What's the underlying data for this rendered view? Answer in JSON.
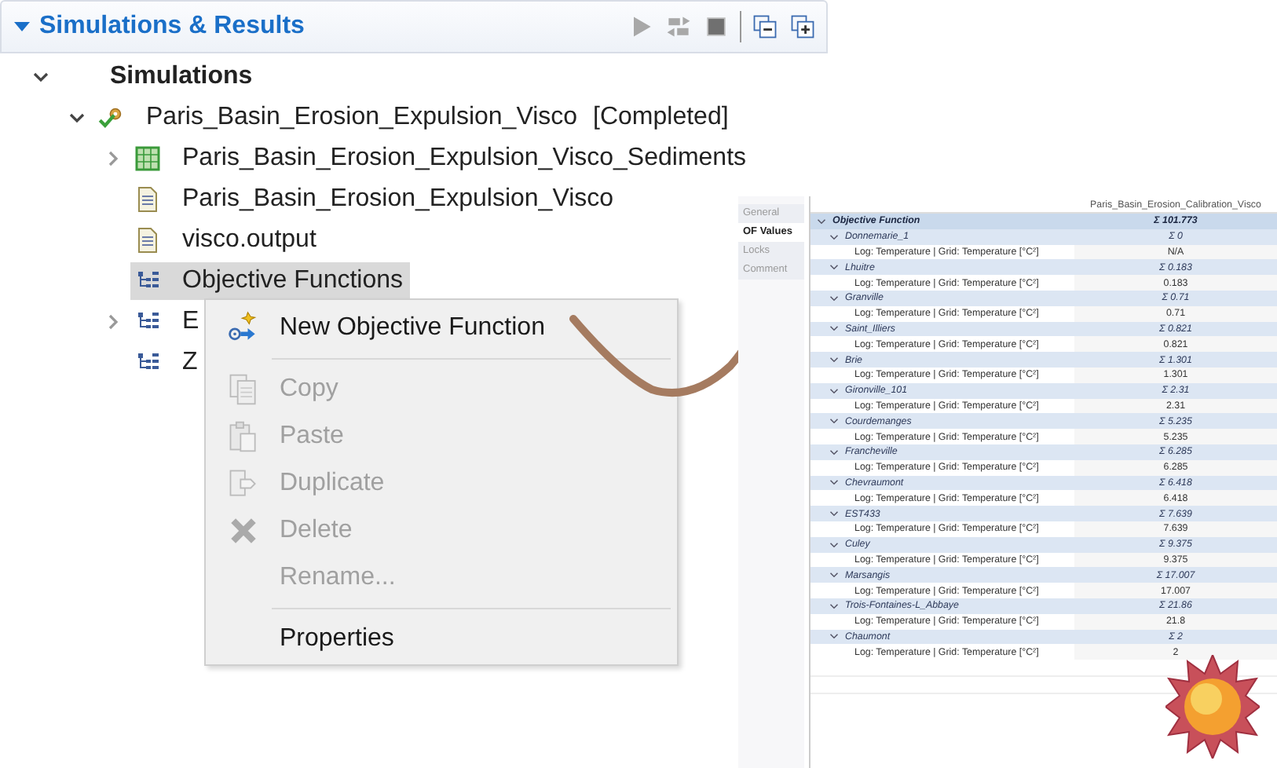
{
  "panel": {
    "title": "Simulations & Results",
    "expanded": true,
    "toolbar": [
      {
        "kind": "run",
        "disabled": true
      },
      {
        "kind": "sync",
        "disabled": true
      },
      {
        "kind": "stop",
        "disabled": true
      },
      {
        "kind": "separator"
      },
      {
        "kind": "collapse",
        "disabled": false
      },
      {
        "kind": "expand",
        "disabled": false
      }
    ]
  },
  "tree": [
    {
      "label": "Simulations",
      "kind": "root",
      "expanded": true,
      "selected": false,
      "children": [
        {
          "label": "Paris_Basin_Erosion_Expulsion_Visco",
          "status": "[Completed]",
          "kind": "simulation",
          "expanded": true,
          "selected": false,
          "children": [
            {
              "label": "Paris_Basin_Erosion_Expulsion_Visco_Sediments",
              "kind": "grid",
              "expanded": false,
              "selected": false
            },
            {
              "label": "Paris_Basin_Erosion_Expulsion_Visco",
              "kind": "file",
              "selected": false
            },
            {
              "label": "visco.output",
              "kind": "file",
              "selected": false
            },
            {
              "label": "Objective Functions",
              "kind": "functions",
              "selected": true
            },
            {
              "label": "E",
              "kind": "functions",
              "expanded": false,
              "selected": false
            },
            {
              "label": "Z",
              "kind": "functions",
              "selected": false
            }
          ]
        }
      ]
    }
  ],
  "context_menu": {
    "items": [
      {
        "kind": "item",
        "label": "New Objective Function",
        "disabled": false
      },
      {
        "kind": "separator"
      },
      {
        "kind": "item",
        "label": "Copy",
        "disabled": true
      },
      {
        "kind": "item",
        "label": "Paste",
        "disabled": true
      },
      {
        "kind": "item",
        "label": "Duplicate",
        "disabled": true
      },
      {
        "kind": "item",
        "label": "Delete",
        "disabled": true
      },
      {
        "kind": "item",
        "label": "Rename...",
        "disabled": true
      },
      {
        "kind": "separator"
      },
      {
        "kind": "item",
        "label": "Properties",
        "disabled": false
      }
    ]
  },
  "inset": {
    "tabs": [
      {
        "label": "General",
        "selected": false
      },
      {
        "label": "OF Values",
        "selected": true
      },
      {
        "label": "Locks",
        "selected": false
      },
      {
        "label": "Comment",
        "selected": false
      }
    ],
    "column_header": "Paris_Basin_Erosion_Calibration_Visco",
    "rows": [
      {
        "label": "Objective Function",
        "value": "Σ 101.773",
        "expanded": true,
        "children": [
          {
            "label": "Donnemarie_1",
            "value": "Σ 0",
            "expanded": true,
            "children": [
              {
                "label": "Log: Temperature | Grid: Temperature [°C²]",
                "value": "N/A"
              }
            ]
          },
          {
            "label": "Lhuitre",
            "value": "Σ 0.183",
            "expanded": true,
            "children": [
              {
                "label": "Log: Temperature | Grid: Temperature [°C²]",
                "value": "0.183"
              }
            ]
          },
          {
            "label": "Granville",
            "value": "Σ 0.71",
            "expanded": true,
            "children": [
              {
                "label": "Log: Temperature | Grid: Temperature [°C²]",
                "value": "0.71"
              }
            ]
          },
          {
            "label": "Saint_Illiers",
            "value": "Σ 0.821",
            "expanded": true,
            "children": [
              {
                "label": "Log: Temperature | Grid: Temperature [°C²]",
                "value": "0.821"
              }
            ]
          },
          {
            "label": "Brie",
            "value": "Σ 1.301",
            "expanded": true,
            "children": [
              {
                "label": "Log: Temperature | Grid: Temperature [°C²]",
                "value": "1.301"
              }
            ]
          },
          {
            "label": "Gironville_101",
            "value": "Σ 2.31",
            "expanded": true,
            "children": [
              {
                "label": "Log: Temperature | Grid: Temperature [°C²]",
                "value": "2.31"
              }
            ]
          },
          {
            "label": "Courdemanges",
            "value": "Σ 5.235",
            "expanded": true,
            "children": [
              {
                "label": "Log: Temperature | Grid: Temperature [°C²]",
                "value": "5.235"
              }
            ]
          },
          {
            "label": "Francheville",
            "value": "Σ 6.285",
            "expanded": true,
            "children": [
              {
                "label": "Log: Temperature | Grid: Temperature [°C²]",
                "value": "6.285"
              }
            ]
          },
          {
            "label": "Chevraumont",
            "value": "Σ 6.418",
            "expanded": true,
            "children": [
              {
                "label": "Log: Temperature | Grid: Temperature [°C²]",
                "value": "6.418"
              }
            ]
          },
          {
            "label": "EST433",
            "value": "Σ 7.639",
            "expanded": true,
            "children": [
              {
                "label": "Log: Temperature | Grid: Temperature [°C²]",
                "value": "7.639"
              }
            ]
          },
          {
            "label": "Culey",
            "value": "Σ 9.375",
            "expanded": true,
            "children": [
              {
                "label": "Log: Temperature | Grid: Temperature [°C²]",
                "value": "9.375"
              }
            ]
          },
          {
            "label": "Marsangis",
            "value": "Σ 17.007",
            "expanded": true,
            "children": [
              {
                "label": "Log: Temperature | Grid: Temperature [°C²]",
                "value": "17.007"
              }
            ]
          },
          {
            "label": "Trois-Fontaines-L_Abbaye",
            "value": "Σ 21.86",
            "expanded": true,
            "children": [
              {
                "label": "Log: Temperature | Grid: Temperature [°C²]",
                "value": "21.8"
              }
            ]
          },
          {
            "label": "Chaumont",
            "value": "Σ 2",
            "expanded": true,
            "children": [
              {
                "label": "Log: Temperature | Grid: Temperature [°C²]",
                "value": "2"
              }
            ]
          }
        ]
      }
    ]
  }
}
